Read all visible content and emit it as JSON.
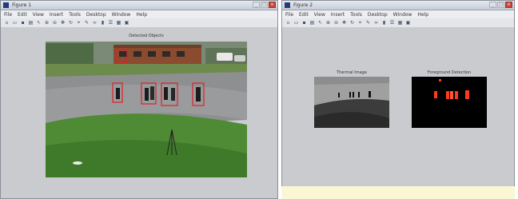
{
  "window1": {
    "title": "Figure 1",
    "menu": [
      "File",
      "Edit",
      "View",
      "Insert",
      "Tools",
      "Desktop",
      "Window",
      "Help"
    ],
    "toolbar_icons": [
      "new-file-icon",
      "open-folder-icon",
      "save-icon",
      "print-icon",
      "pointer-icon",
      "zoom-in-icon",
      "zoom-out-icon",
      "pan-icon",
      "rotate-icon",
      "data-cursor-icon",
      "brush-icon",
      "link-icon",
      "colorbar-icon",
      "legend-icon",
      "grid-icon",
      "layout-icon"
    ],
    "axes_title": "Detected Objects"
  },
  "window2": {
    "title": "Figure 2",
    "menu": [
      "File",
      "Edit",
      "View",
      "Insert",
      "Tools",
      "Desktop",
      "Window",
      "Help"
    ],
    "toolbar_icons": [
      "new-file-icon",
      "open-folder-icon",
      "save-icon",
      "print-icon",
      "pointer-icon",
      "zoom-in-icon",
      "zoom-out-icon",
      "pan-icon",
      "rotate-icon",
      "data-cursor-icon",
      "brush-icon",
      "link-icon",
      "colorbar-icon",
      "legend-icon",
      "grid-icon",
      "layout-icon"
    ],
    "axes_left_title": "Thermal Image",
    "axes_right_title": "Foreground Detection"
  },
  "window_controls": {
    "minimize": "_",
    "maximize": "□",
    "close": "✕"
  },
  "colors": {
    "detection_box": "#e0202a",
    "foreground_blob": "#ff3a1f",
    "accent": "#243b7a"
  }
}
